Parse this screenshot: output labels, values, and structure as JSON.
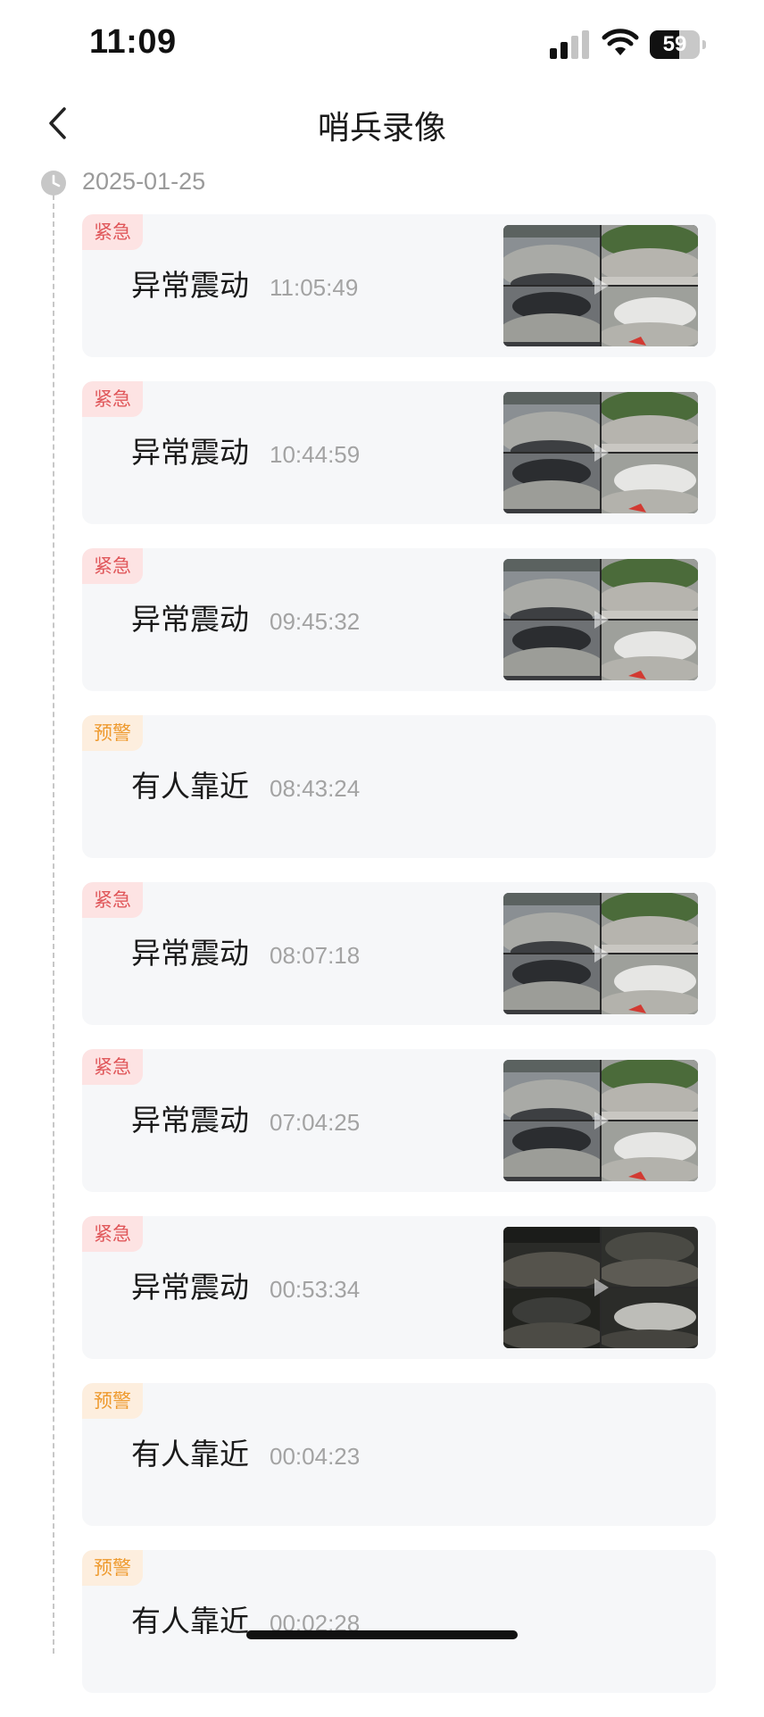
{
  "status_bar": {
    "time": "11:09",
    "battery": "59",
    "battery_level_percent": 59,
    "signal_icon": "cellular-signal-icon",
    "wifi_icon": "wifi-icon",
    "battery_icon": "battery-icon"
  },
  "nav": {
    "back_icon": "chevron-left-icon",
    "title": "哨兵录像"
  },
  "timeline": {
    "date_icon": "clock-icon",
    "date": "2025-01-25"
  },
  "colors": {
    "urgent_text": "#e0575a",
    "urgent_bg": "#fde3e3",
    "warning_text": "#ee9a2e",
    "warning_bg": "#fdeede",
    "card_bg": "#f6f7f9",
    "time_gray": "#a3a3a3"
  },
  "records": [
    {
      "level": "紧急",
      "event": "异常震动",
      "time": "11:05:49",
      "has_thumbnail": true,
      "thumb_scene": "day"
    },
    {
      "level": "紧急",
      "event": "异常震动",
      "time": "10:44:59",
      "has_thumbnail": true,
      "thumb_scene": "day"
    },
    {
      "level": "紧急",
      "event": "异常震动",
      "time": "09:45:32",
      "has_thumbnail": true,
      "thumb_scene": "day"
    },
    {
      "level": "预警",
      "event": "有人靠近",
      "time": "08:43:24",
      "has_thumbnail": false
    },
    {
      "level": "紧急",
      "event": "异常震动",
      "time": "08:07:18",
      "has_thumbnail": true,
      "thumb_scene": "day"
    },
    {
      "level": "紧急",
      "event": "异常震动",
      "time": "07:04:25",
      "has_thumbnail": true,
      "thumb_scene": "day"
    },
    {
      "level": "紧急",
      "event": "异常震动",
      "time": "00:53:34",
      "has_thumbnail": true,
      "thumb_scene": "night"
    },
    {
      "level": "预警",
      "event": "有人靠近",
      "time": "00:04:23",
      "has_thumbnail": false
    },
    {
      "level": "预警",
      "event": "有人靠近",
      "time": "00:02:28",
      "has_thumbnail": false
    }
  ]
}
